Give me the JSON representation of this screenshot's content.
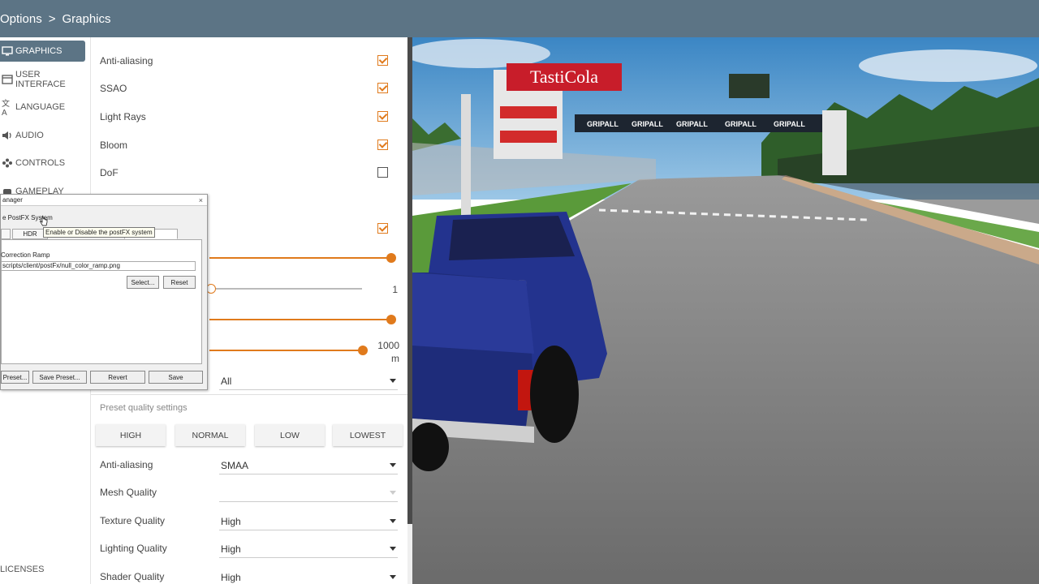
{
  "header": {
    "parent": "Options",
    "separator": ">",
    "current": "Graphics"
  },
  "sidebar": {
    "items": [
      {
        "label": "GRAPHICS",
        "icon": "monitor-icon",
        "active": true
      },
      {
        "label": "USER INTERFACE",
        "icon": "window-icon"
      },
      {
        "label": "LANGUAGE",
        "icon": "translate-icon"
      },
      {
        "label": "AUDIO",
        "icon": "speaker-icon"
      },
      {
        "label": "CONTROLS",
        "icon": "gamepad-icon"
      },
      {
        "label": "GAMEPLAY",
        "icon": "gameplay-icon"
      }
    ],
    "licenses": "LICENSES"
  },
  "settings": {
    "toggles": [
      {
        "label": "Anti-aliasing",
        "checked": true
      },
      {
        "label": "SSAO",
        "checked": true
      },
      {
        "label": "Light Rays",
        "checked": true
      },
      {
        "label": "Bloom",
        "checked": true
      },
      {
        "label": "DoF",
        "checked": false
      }
    ],
    "hidden_toggle_checked": true,
    "sliders": [
      {
        "value_label": "",
        "fraction": 1.0
      },
      {
        "value_label": "1",
        "fraction": 0.0
      },
      {
        "value_label": "",
        "fraction": 1.0
      },
      {
        "value_label": "1000",
        "unit": "m",
        "fraction": 0.95
      }
    ],
    "partial_select": {
      "value": "All"
    },
    "preset_section_label": "Preset quality settings",
    "presets": [
      "HIGH",
      "NORMAL",
      "LOW",
      "LOWEST"
    ],
    "quality": [
      {
        "label": "Anti-aliasing",
        "value": "SMAA"
      },
      {
        "label": "Mesh Quality",
        "value": ""
      },
      {
        "label": "Texture Quality",
        "value": "High"
      },
      {
        "label": "Lighting Quality",
        "value": "High"
      },
      {
        "label": "Shader Quality",
        "value": "High"
      }
    ]
  },
  "dialog": {
    "title": "anager",
    "close": "×",
    "enable_label": "e PostFX System",
    "tooltip": "Enable or Disable the postFX system",
    "tabs": [
      "",
      "HDR",
      "orrection"
    ],
    "ramp_label": "Correction Ramp",
    "path": "scripts/client/postFx/null_color_ramp.png",
    "select_button": "Select...",
    "reset_button": "Reset",
    "bottom_buttons": [
      "Preset...",
      "Save Preset...",
      "Revert",
      "Save"
    ]
  },
  "scene": {
    "sponsor_sign": "TastiCola",
    "banner_text": "GRIPALL"
  },
  "colors": {
    "accent": "#e07a1c",
    "header": "#5c7485"
  }
}
